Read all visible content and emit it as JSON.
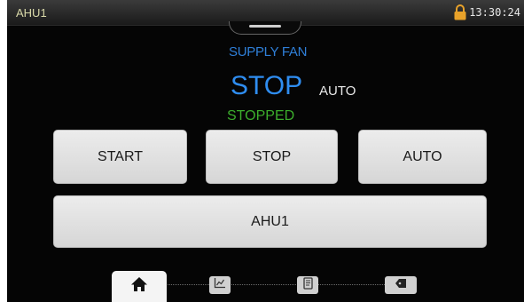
{
  "header": {
    "title": "AHU1",
    "clock": "13:30:24",
    "lock_icon": "lock-icon"
  },
  "fan": {
    "section_label": "SUPPLY FAN",
    "command": "STOP",
    "mode": "AUTO",
    "state": "STOPPED"
  },
  "buttons": {
    "start": "START",
    "stop": "STOP",
    "auto": "AUTO",
    "ahu": "AHU1"
  },
  "nav": {
    "icons": [
      "home-icon",
      "trend-chart-icon",
      "report-icon",
      "tag-icon"
    ],
    "active": "home-icon"
  },
  "colors": {
    "background": "#050505",
    "header_title": "#d8d8a8",
    "command": "#2f8df0",
    "section_label": "#2f7fd8",
    "state": "#3cae2c",
    "button": "#e2e2e2",
    "lock": "#e8a22a"
  }
}
